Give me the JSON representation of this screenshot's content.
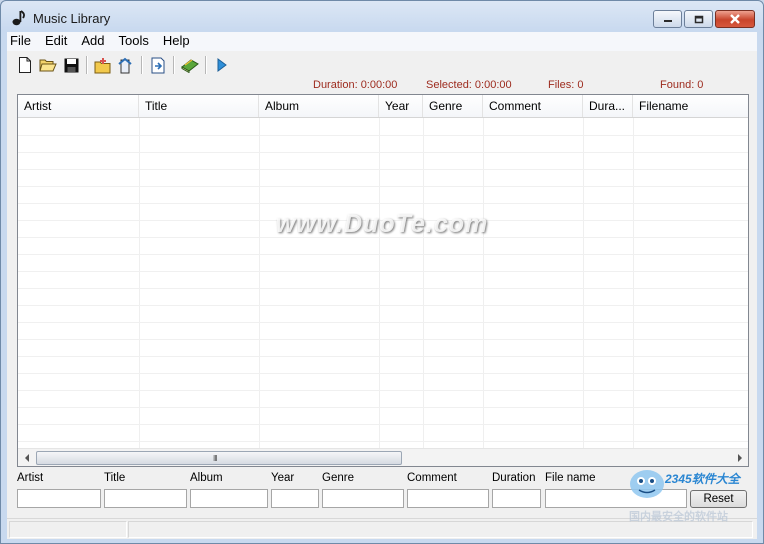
{
  "window": {
    "title": "Music Library"
  },
  "menu": [
    "File",
    "Edit",
    "Add",
    "Tools",
    "Help"
  ],
  "toolbar": [
    "new-file-icon",
    "open-folder-icon",
    "save-icon",
    "add-folder-icon",
    "add-file-icon",
    "export-icon",
    "library-book-icon",
    "play-icon"
  ],
  "status": {
    "duration": "Duration: 0:00:00",
    "selected": "Selected: 0:00:00",
    "files": "Files: 0",
    "found": "Found: 0"
  },
  "list": {
    "columns": [
      "Artist",
      "Title",
      "Album",
      "Year",
      "Genre",
      "Comment",
      "Dura...",
      "Filename"
    ],
    "scroll_grip": "III"
  },
  "watermark": "www.DuoTe.com",
  "filters": {
    "labels": [
      "Artist",
      "Title",
      "Album",
      "Year",
      "Genre",
      "Comment",
      "Duration",
      "File name"
    ],
    "reset": "Reset"
  },
  "brand_logo": {
    "line1": "2345软件大全",
    "line2": "国内最安全的软件站"
  },
  "colors": {
    "status_text": "#9d2b1e",
    "accent": "#1f6fc0"
  }
}
